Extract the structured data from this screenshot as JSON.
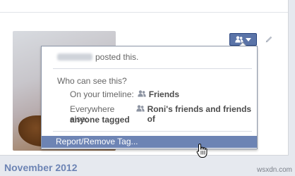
{
  "post": {
    "posted_this": "posted this."
  },
  "privacy_menu": {
    "who_can_see": "Who can see this?",
    "timeline_label": "On your timeline:",
    "timeline_value": "Friends",
    "elsewhere_label": "Everywhere else:",
    "elsewhere_value_line1": "Roni's friends and friends of",
    "elsewhere_value_line2": "anyone tagged",
    "report_item": "Report/Remove Tag..."
  },
  "timeline": {
    "month_heading": "November 2012"
  },
  "watermark": "wsxdn.com",
  "colors": {
    "accent": "#6d84b4",
    "button": "#5b74a8",
    "background": "#e6e9ef"
  },
  "icons": {
    "privacy_button": "friends-icon",
    "dropdown": "chevron-down-icon",
    "edit": "pencil-icon",
    "cursor": "hand-pointer-icon"
  }
}
